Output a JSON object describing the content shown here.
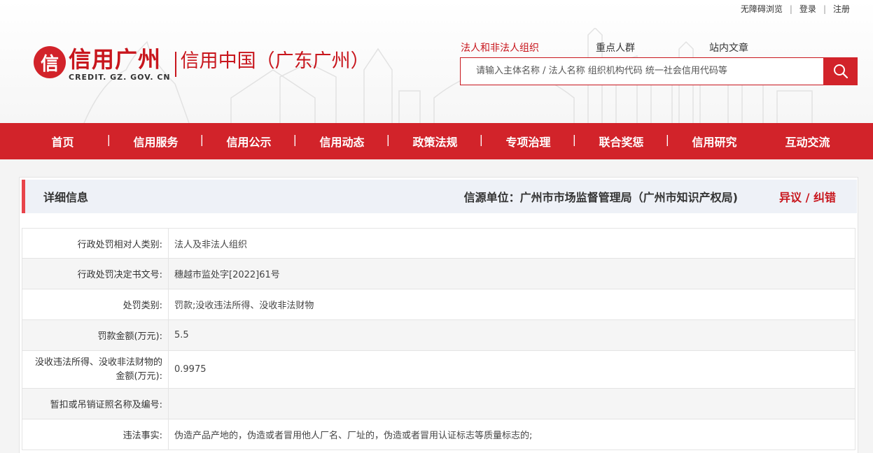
{
  "toplinks": {
    "accessibility": "无障碍浏览",
    "login": "登录",
    "register": "注册"
  },
  "logo": {
    "mark": "信",
    "cn": "信用广州",
    "en": "CREDIT. GZ. GOV. CN",
    "sub": "信用中国（广东广州）"
  },
  "search": {
    "tabs": [
      "法人和非法人组织",
      "重点人群",
      "站内文章"
    ],
    "active_tab": 0,
    "placeholder": "请输入主体名称 / 法人名称  组织机构代码 统一社会信用代码等",
    "button_icon": "search-icon"
  },
  "nav": {
    "items": [
      "首页",
      "信用服务",
      "信用公示",
      "信用动态",
      "政策法规",
      "专项治理",
      "联合奖惩",
      "信用研究",
      "互动交流"
    ]
  },
  "panel": {
    "title": "详细信息",
    "source": "信源单位：广州市市场监督管理局（广州市知识产权局)",
    "objection": "异议 / 纠错"
  },
  "details": [
    {
      "label": "行政处罚相对人类别:",
      "value": "法人及非法人组织"
    },
    {
      "label": "行政处罚决定书文号:",
      "value": "穗越市监处字[2022]61号"
    },
    {
      "label": "处罚类别:",
      "value": "罚款;没收违法所得、没收非法财物"
    },
    {
      "label": "罚款金额(万元):",
      "value": "5.5"
    },
    {
      "label": "没收违法所得、没收非法财物的金额(万元):",
      "value": "0.9975"
    },
    {
      "label": "暂扣或吊销证照名称及编号:",
      "value": ""
    },
    {
      "label": "违法事实:",
      "value": "伪造产品产地的，伪造或者冒用他人厂名、厂址的，伪造或者冒用认证标志等质量标志的;"
    }
  ],
  "colors": {
    "brand_red": "#d2232a",
    "accent_bar": "#e8444b",
    "panel_head_bg": "#eef1f7"
  }
}
